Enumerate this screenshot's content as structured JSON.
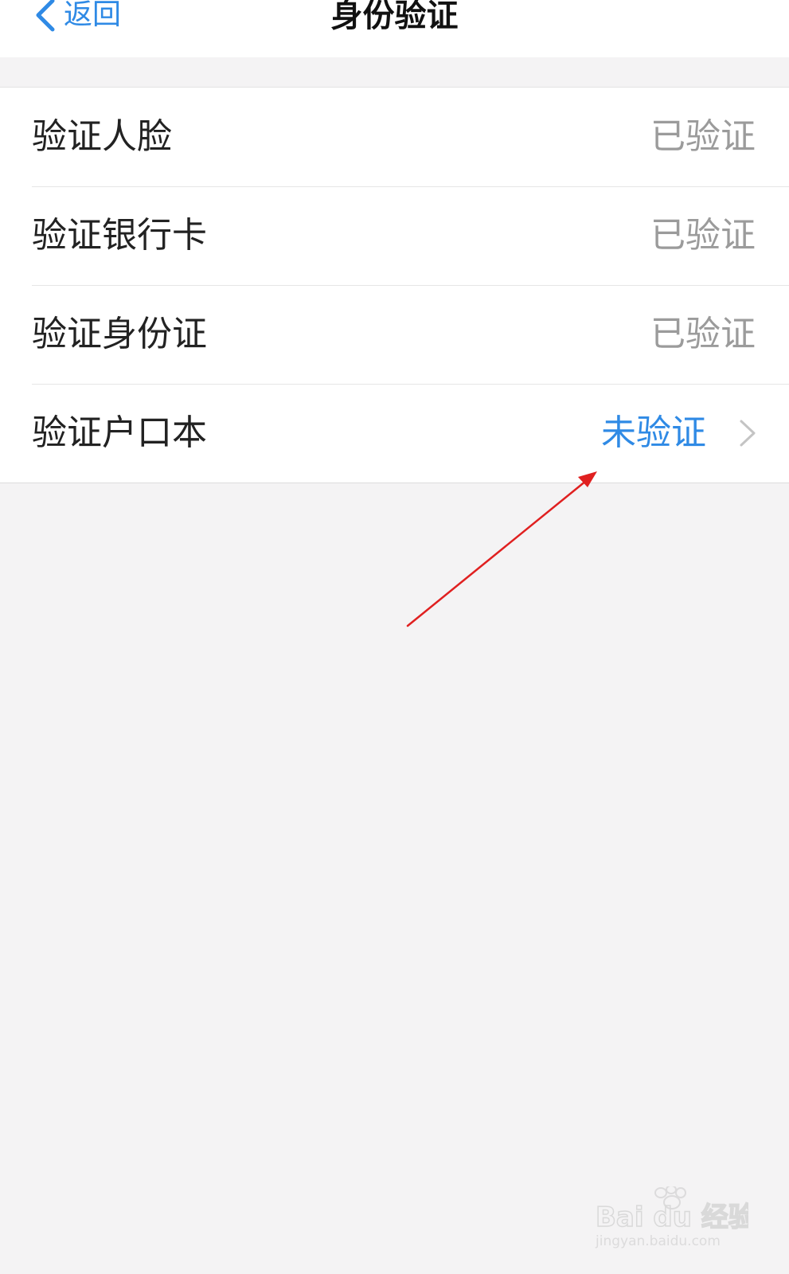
{
  "navbar": {
    "back_label": "返回",
    "title": "身份验证"
  },
  "verify_list": [
    {
      "label": "验证人脸",
      "status": "已验证"
    },
    {
      "label": "验证银行卡",
      "status": "已验证"
    },
    {
      "label": "验证身份证",
      "status": "已验证"
    },
    {
      "label": "验证户口本",
      "status": "未验证"
    }
  ],
  "watermark": {
    "brand": "Bai du 经验",
    "url": "jingyan.baidu.com"
  },
  "colors": {
    "accent_blue": "#2f8ae5",
    "verified_gray": "#9b9b9b",
    "annotation_red": "#e02020",
    "page_background": "#f4f3f4"
  },
  "icons": {
    "back": "chevron-left-icon",
    "row_disclosure": "chevron-right-icon",
    "annotation": "red-arrow-icon"
  }
}
